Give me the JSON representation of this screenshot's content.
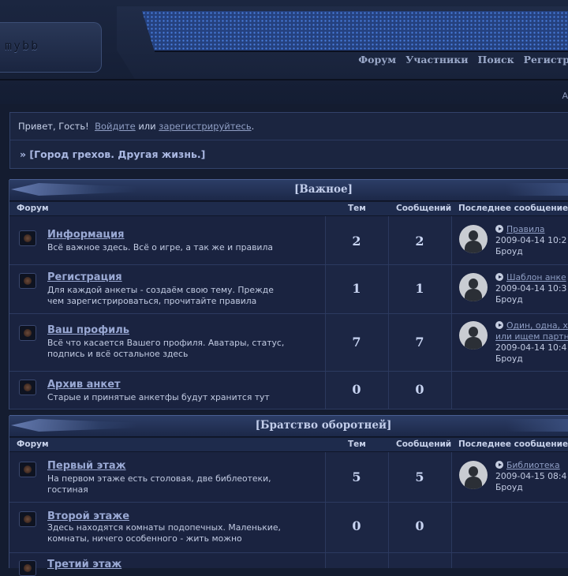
{
  "header": {
    "logo": "mybb",
    "nav": [
      "Форум",
      "Участники",
      "Поиск",
      "Регистр"
    ],
    "corner": "А"
  },
  "welcome": {
    "greeting": "Привет, Гость!",
    "login": "Войдите",
    "or": "или",
    "register": "зарегистрируйтесь",
    "period": ".",
    "board_title": "» [Город грехов. Другая жизнь.]"
  },
  "columns": {
    "forum": "Форум",
    "topics": "Тем",
    "posts": "Сообщений",
    "last": "Последнее сообщение"
  },
  "categories": [
    {
      "title": "[Важное]",
      "forums": [
        {
          "title": "Информация",
          "desc": "Всё важное здесь. Всё о игре, а так же и правила",
          "topics": "2",
          "posts": "2",
          "last": {
            "title": "Правила",
            "date": "2009-04-14 10:2",
            "author": "Броуд"
          }
        },
        {
          "title": "Регистрация",
          "desc": "Для каждой анкеты - создаём свою тему. Прежде чем зарегистрироваться, прочитайте правила",
          "topics": "1",
          "posts": "1",
          "last": {
            "title": "Шаблон анке",
            "date": "2009-04-14 10:3",
            "author": "Броуд"
          }
        },
        {
          "title": "Ваш профиль",
          "desc": "Всё что касается Вашего профиля. Аватары, статус, подпись и всё остальное здесь",
          "topics": "7",
          "posts": "7",
          "last": {
            "title": "Один, одна, х",
            "title2": "или ищем партн",
            "date": "2009-04-14 10:4",
            "author": "Броуд"
          }
        },
        {
          "title": "Архив анкет",
          "desc": "Старые и принятые анкетфы будут хранится тут",
          "topics": "0",
          "posts": "0"
        }
      ]
    },
    {
      "title": "[Братство оборотней]",
      "forums": [
        {
          "title": "Первый этаж",
          "desc": "На первом этаже есть столовая, две библеотеки, гостиная",
          "topics": "5",
          "posts": "5",
          "last": {
            "title": "Библиотека",
            "date": "2009-04-15 08:4",
            "author": "Броуд"
          }
        },
        {
          "title": "Второй этаже",
          "desc": "Здесь находятся комнаты подопечных. Маленькие, комнаты, ничего особенного - жить можно",
          "topics": "0",
          "posts": "0"
        },
        {
          "title": "Третий этаж"
        }
      ]
    }
  ]
}
